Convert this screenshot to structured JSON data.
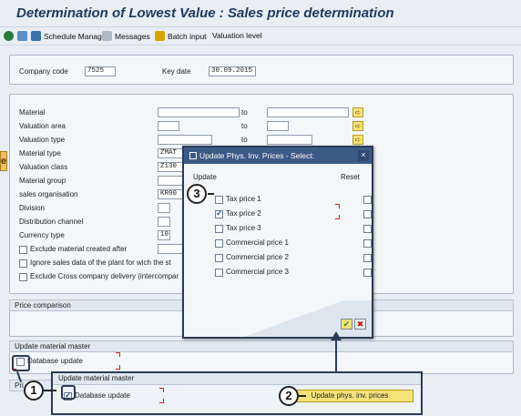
{
  "window": {
    "title": "Determination of Lowest Value : Sales price determination"
  },
  "toolbar": {
    "schedule_manager": "Schedule Manager",
    "messages": "Messages",
    "batch_input": "Batch input",
    "valuation_level": "Valuation level"
  },
  "header_fields": {
    "company_code_label": "Company code",
    "company_code_value": "7525",
    "key_date_label": "Key date",
    "key_date_value": "30.09.2015"
  },
  "selection": {
    "to_label": "to",
    "rows": [
      {
        "label": "Material",
        "value": ""
      },
      {
        "label": "Valuation area",
        "value": ""
      },
      {
        "label": "Valuation type",
        "value": ""
      },
      {
        "label": "Material type",
        "value": "ZMAT"
      },
      {
        "label": "Valuation class",
        "value": "Z130"
      },
      {
        "label": "Material group",
        "value": ""
      },
      {
        "label": "sales organisation",
        "value": "KR00"
      },
      {
        "label": "Division",
        "value": ""
      },
      {
        "label": "Distribution channel",
        "value": ""
      },
      {
        "label": "Currency type",
        "value": "10"
      }
    ],
    "checkboxes": [
      {
        "label": "Exclude  material created after",
        "checked": false
      },
      {
        "label": "Ignore sales data of the plant for wich the st",
        "checked": false
      },
      {
        "label": "Exclude Cross company delivery  (intercompar",
        "checked": false
      }
    ]
  },
  "sections": {
    "price_comparison": "Price comparison",
    "update_material_master": "Update material master",
    "database_update": "Database update",
    "pri_partial": "Pri"
  },
  "dialog": {
    "title": "Update Phys. Inv. Prices - Select:",
    "col_update": "Update",
    "col_reset": "Reset",
    "items": [
      {
        "label": "Tax price 1",
        "update": false,
        "reset": false
      },
      {
        "label": "Tax price 2",
        "update": true,
        "reset": false
      },
      {
        "label": "Tax price 3",
        "update": false,
        "reset": false
      },
      {
        "label": "Commercial price 1",
        "update": false,
        "reset": false
      },
      {
        "label": "Commercial price 2",
        "update": false,
        "reset": false
      },
      {
        "label": "Commercial price 3",
        "update": false,
        "reset": false
      }
    ]
  },
  "zoom_panel": {
    "title": "Update material master",
    "database_update": "Database update",
    "button": "Update phys. inv. prices"
  },
  "callouts": [
    "1",
    "2",
    "3"
  ],
  "side_tab": "e",
  "colors": {
    "title_text": "#1e3a5f",
    "dialog_title_bg": "#3c5a86",
    "button_yellow": "#f6e27a",
    "callout_arrow": "#2a3c55"
  }
}
